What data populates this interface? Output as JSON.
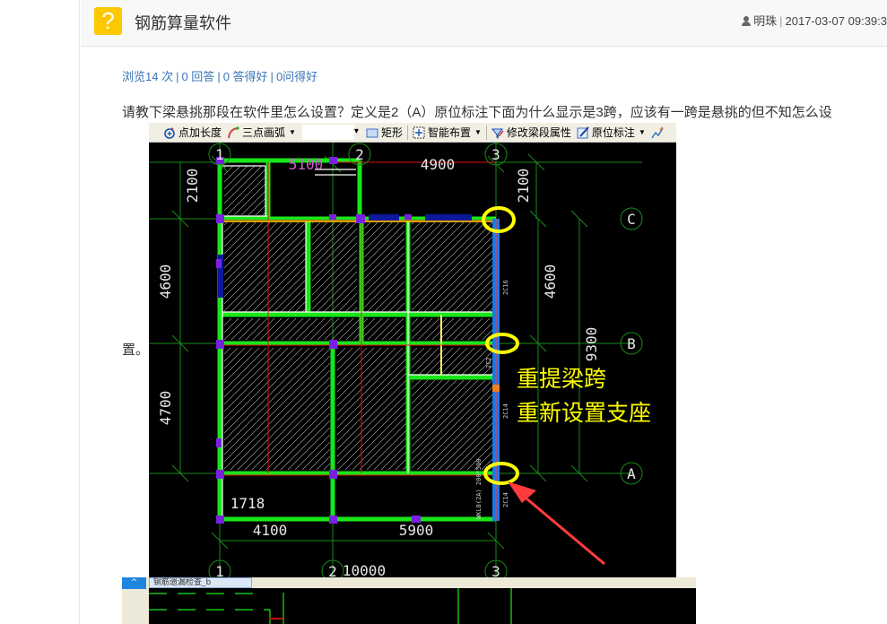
{
  "header": {
    "category_icon": "question-mark-icon",
    "category_glyph": "?",
    "title": "钢筋算量软件",
    "author_icon": "user-icon",
    "author": "明珠",
    "separator": "|",
    "timestamp": "2017-03-07 09:39:3"
  },
  "stats": {
    "views": "浏览14 次",
    "answers": "0 回答",
    "good_answers": "0 答得好",
    "good_questions": "0问得好",
    "separator": "|"
  },
  "question": {
    "line1": "请教下梁悬挑那段在软件里怎么设置？定义是2（A）原位标注下面为什么显示是3跨，应该有一跨是悬挑的但不知怎么设",
    "line2": "置。"
  },
  "embedded_screenshot": {
    "toolbar": {
      "items": [
        {
          "label": "点加长度",
          "icon": "point-add-length-icon"
        },
        {
          "label": "三点画弧",
          "icon": "three-point-arc-icon",
          "dropdown": true
        },
        {
          "label": "",
          "icon": "",
          "select": true
        },
        {
          "label": "矩形",
          "icon": "rectangle-icon"
        },
        {
          "label": "智能布置",
          "icon": "smart-layout-icon",
          "dropdown": true
        },
        {
          "label": "修改梁段属性",
          "icon": "modify-beam-properties-icon"
        },
        {
          "label": "原位标注",
          "icon": "in-situ-annotation-icon",
          "dropdown": true
        }
      ]
    },
    "cad": {
      "axis_labels_x": [
        "1",
        "2",
        "3"
      ],
      "axis_labels_y": [
        "C",
        "B",
        "A"
      ],
      "dimensions_top": [
        "5100",
        "4900"
      ],
      "dimensions_bottom": [
        "4100",
        "5900",
        "10000"
      ],
      "dimensions_left": [
        "2100",
        "4600",
        "4700"
      ],
      "dimensions_right": [
        "2100",
        "4600",
        "9300"
      ],
      "dimension_misc": "1718",
      "beam_labels": [
        "2C16",
        "2C14",
        "2C14",
        "2C2"
      ],
      "beam_annotation": "WKL8(2A) 200*500",
      "annotation_line1": "重提梁跨",
      "annotation_line2": "重新设置支座",
      "highlight_color": "#ffff00",
      "arrow_color": "#ff3b3b"
    },
    "second_tab_label": "钢筋遗漏检查_b"
  }
}
